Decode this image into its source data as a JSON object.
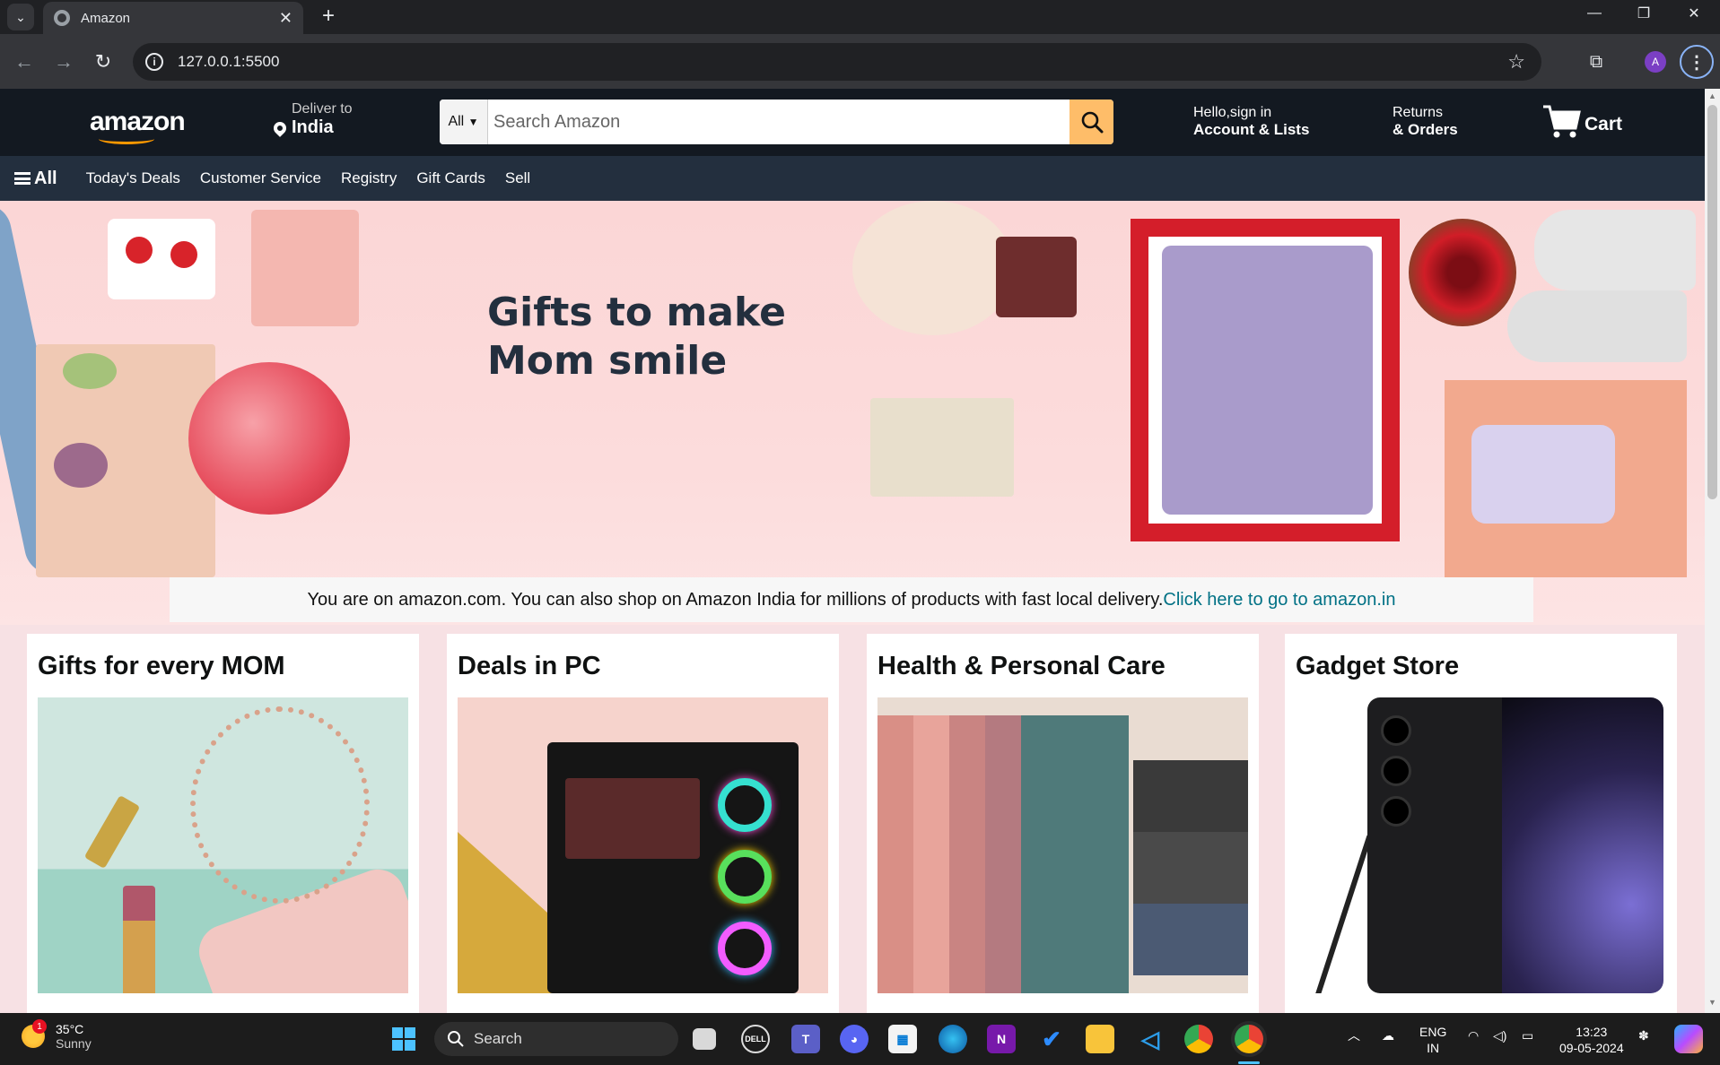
{
  "browser": {
    "tab_title": "Amazon",
    "url": "127.0.0.1:5500",
    "profile_initial": "A"
  },
  "header": {
    "logo_text": "amazon",
    "deliver_line1": "Deliver to",
    "deliver_line2": "India",
    "search_dept": "All",
    "search_placeholder": "Search Amazon",
    "account_line1": "Hello,sign in",
    "account_line2": "Account & Lists",
    "returns_line1": "Returns",
    "returns_line2": "& Orders",
    "cart_label": "Cart"
  },
  "nav": {
    "all_label": "All",
    "links": [
      "Today's Deals",
      "Customer Service",
      "Registry",
      "Gift Cards",
      "Sell"
    ]
  },
  "hero": {
    "headline": "Gifts to make Mom smile",
    "banner_text": "You are on amazon.com. You can also shop on Amazon India for millions of products with fast local delivery.",
    "banner_link": "Click here to go to amazon.in"
  },
  "cards": [
    {
      "title": "Gifts for every MOM"
    },
    {
      "title": "Deals in PC"
    },
    {
      "title": "Health & Personal Care"
    },
    {
      "title": "Gadget Store"
    }
  ],
  "taskbar": {
    "temp": "35°C",
    "condition": "Sunny",
    "weather_badge": "1",
    "search_label": "Search",
    "lang_line1": "ENG",
    "lang_line2": "IN",
    "time": "13:23",
    "date": "09-05-2024"
  },
  "colors": {
    "amazon_dark": "#131921",
    "amazon_nav": "#232f3e",
    "amazon_orange": "#febd69",
    "link_teal": "#007185"
  }
}
